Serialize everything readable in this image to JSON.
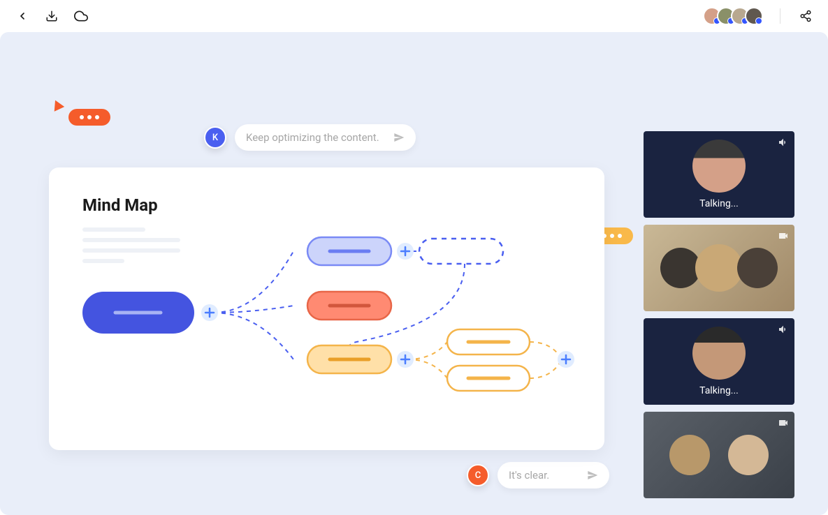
{
  "topbar": {
    "avatars": [
      "A1",
      "A2",
      "A3",
      "A4"
    ]
  },
  "cursors": {
    "orange": {
      "color": "#f55c2b"
    },
    "yellow": {
      "color": "#f9b94a"
    }
  },
  "comments": {
    "top": {
      "initial": "K",
      "avatar_bg": "#4a5ff0",
      "text": "Keep optimizing the content."
    },
    "bottom": {
      "initial": "C",
      "avatar_bg": "#f55c2b",
      "text": "It's clear."
    }
  },
  "canvas": {
    "title": "Mind Map"
  },
  "mindmap": {
    "nodes": {
      "root": {
        "fill": "#4454e0",
        "stroke": "#4454e0",
        "line": "#a9b3f4"
      },
      "child_purple": {
        "fill": "#ccd4fb",
        "stroke": "#7a8af5",
        "line": "#6a7df2"
      },
      "child_red": {
        "fill": "#ff8a72",
        "stroke": "#e86648",
        "line": "#d2563c"
      },
      "child_yellow": {
        "fill": "#ffe0a8",
        "stroke": "#f4b44a",
        "line": "#e99f28"
      },
      "dashed": {
        "stroke": "#4a5ff0"
      },
      "leaf_yellow": {
        "fill": "#ffffff",
        "stroke": "#f4b44a",
        "line": "#f4b44a"
      }
    }
  },
  "video": {
    "tiles": [
      {
        "type": "avatar",
        "status": "Talking...",
        "icon": "audio"
      },
      {
        "type": "photo",
        "icon": "video"
      },
      {
        "type": "avatar",
        "status": "Talking...",
        "icon": "audio"
      },
      {
        "type": "photo",
        "icon": "video"
      }
    ]
  }
}
